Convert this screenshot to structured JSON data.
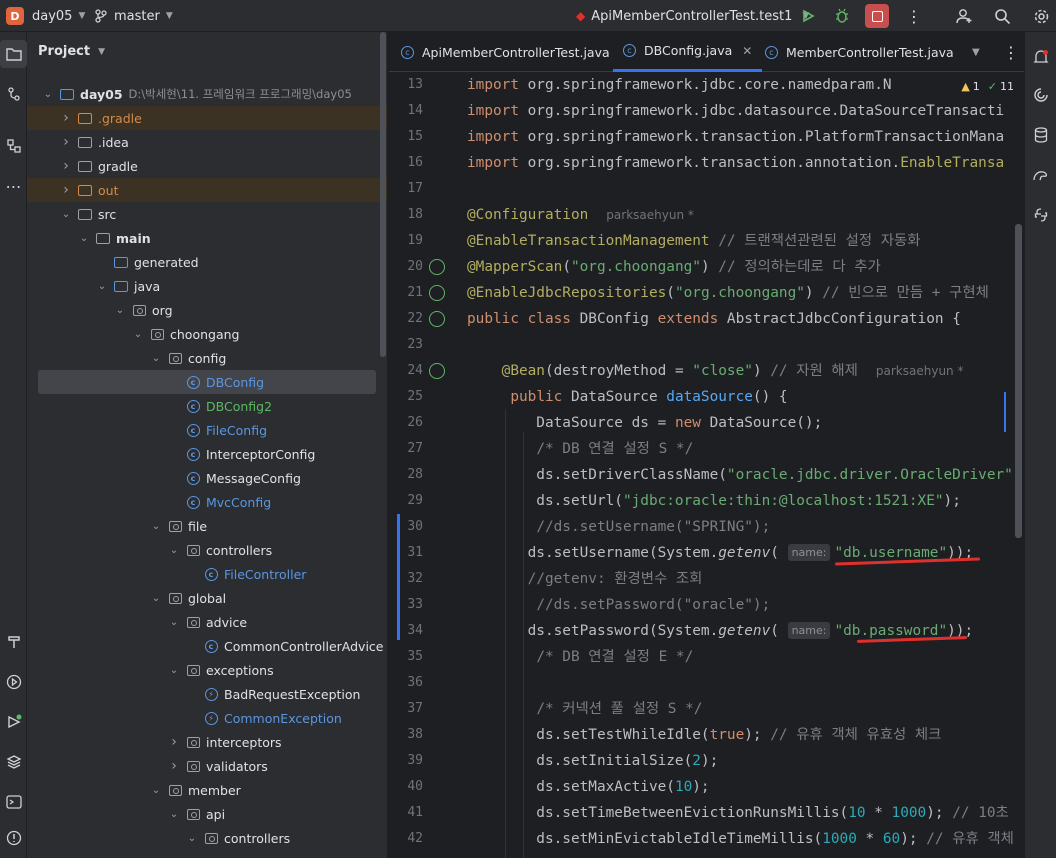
{
  "topbar": {
    "project_initial": "D",
    "project_name": "day05",
    "branch": "master",
    "run_config": "ApiMemberControllerTest.test1"
  },
  "project_panel": {
    "title": "Project",
    "root_label": "day05",
    "root_path": "D:\\박세현\\11. 프레임워크 프로그래밍\\day05",
    "tree": [
      {
        "label": ".gradle",
        "type": "folder-orange",
        "depth": 1,
        "arrow": "right",
        "highlight": "orange"
      },
      {
        "label": ".idea",
        "type": "folder",
        "depth": 1,
        "arrow": "right"
      },
      {
        "label": "gradle",
        "type": "folder",
        "depth": 1,
        "arrow": "right"
      },
      {
        "label": "out",
        "type": "folder-orange",
        "depth": 1,
        "arrow": "right",
        "highlight": "orange"
      },
      {
        "label": "src",
        "type": "folder",
        "depth": 1,
        "arrow": "down"
      },
      {
        "label": "main",
        "type": "folder",
        "depth": 2,
        "arrow": "down",
        "bold": true
      },
      {
        "label": "generated",
        "type": "folder-blue",
        "depth": 3,
        "arrow": ""
      },
      {
        "label": "java",
        "type": "folder-blue",
        "depth": 3,
        "arrow": "down"
      },
      {
        "label": "org",
        "type": "pkg",
        "depth": 4,
        "arrow": "down"
      },
      {
        "label": "choongang",
        "type": "pkg",
        "depth": 5,
        "arrow": "down"
      },
      {
        "label": "config",
        "type": "pkg",
        "depth": 6,
        "arrow": "down"
      },
      {
        "label": "DBConfig",
        "type": "class",
        "depth": 7,
        "arrow": "",
        "color": "#5b97e0",
        "selected": true
      },
      {
        "label": "DBConfig2",
        "type": "class",
        "depth": 7,
        "arrow": "",
        "color": "#5fb865"
      },
      {
        "label": "FileConfig",
        "type": "class",
        "depth": 7,
        "arrow": "",
        "color": "#5b97e0"
      },
      {
        "label": "InterceptorConfig",
        "type": "class",
        "depth": 7,
        "arrow": ""
      },
      {
        "label": "MessageConfig",
        "type": "class",
        "depth": 7,
        "arrow": ""
      },
      {
        "label": "MvcConfig",
        "type": "class",
        "depth": 7,
        "arrow": "",
        "color": "#5b97e0"
      },
      {
        "label": "file",
        "type": "pkg",
        "depth": 6,
        "arrow": "down"
      },
      {
        "label": "controllers",
        "type": "pkg",
        "depth": 7,
        "arrow": "down"
      },
      {
        "label": "FileController",
        "type": "class",
        "depth": 8,
        "arrow": "",
        "color": "#5b97e0"
      },
      {
        "label": "global",
        "type": "pkg",
        "depth": 6,
        "arrow": "down"
      },
      {
        "label": "advice",
        "type": "pkg",
        "depth": 7,
        "arrow": "down"
      },
      {
        "label": "CommonControllerAdvice",
        "type": "class",
        "depth": 8,
        "arrow": ""
      },
      {
        "label": "exceptions",
        "type": "pkg",
        "depth": 7,
        "arrow": "down"
      },
      {
        "label": "BadRequestException",
        "type": "exception",
        "depth": 8,
        "arrow": ""
      },
      {
        "label": "CommonException",
        "type": "exception",
        "depth": 8,
        "arrow": "",
        "color": "#5b97e0"
      },
      {
        "label": "interceptors",
        "type": "pkg",
        "depth": 7,
        "arrow": "right"
      },
      {
        "label": "validators",
        "type": "pkg",
        "depth": 7,
        "arrow": "right"
      },
      {
        "label": "member",
        "type": "pkg",
        "depth": 6,
        "arrow": "down"
      },
      {
        "label": "api",
        "type": "pkg",
        "depth": 7,
        "arrow": "down"
      },
      {
        "label": "controllers",
        "type": "pkg",
        "depth": 8,
        "arrow": "down"
      }
    ]
  },
  "editor": {
    "tabs": [
      {
        "label": "ApiMemberControllerTest.java",
        "active": false
      },
      {
        "label": "DBConfig.java",
        "active": true
      },
      {
        "label": "MemberControllerTest.java",
        "active": false
      }
    ],
    "problems": {
      "warnings": "1",
      "ok": "11"
    },
    "first_line": 13,
    "author": "parksaehyun *"
  },
  "colors": {
    "accent": "#3574f0",
    "keyword": "#cf8e6d",
    "annotation": "#b3ae60",
    "string": "#6aab73",
    "comment": "#7a7e85",
    "method": "#56a8f5",
    "number": "#2aacb8",
    "underline": "#e0302d"
  },
  "icons": {
    "topbar": [
      "branch-icon",
      "run-icon",
      "debug-icon",
      "stop-icon",
      "more-icon",
      "add-user-icon",
      "search-icon",
      "settings-icon"
    ],
    "left_strip": [
      "project-icon",
      "commit-icon",
      "structure-icon",
      "more-tools-icon",
      "build-icon",
      "run-tool-icon",
      "terminal-icon",
      "problems-icon",
      "layers-icon",
      "git-icon"
    ],
    "right_strip": [
      "notifications-icon",
      "copilot-icon",
      "database-icon",
      "gradle-icon",
      "python-icon"
    ]
  }
}
